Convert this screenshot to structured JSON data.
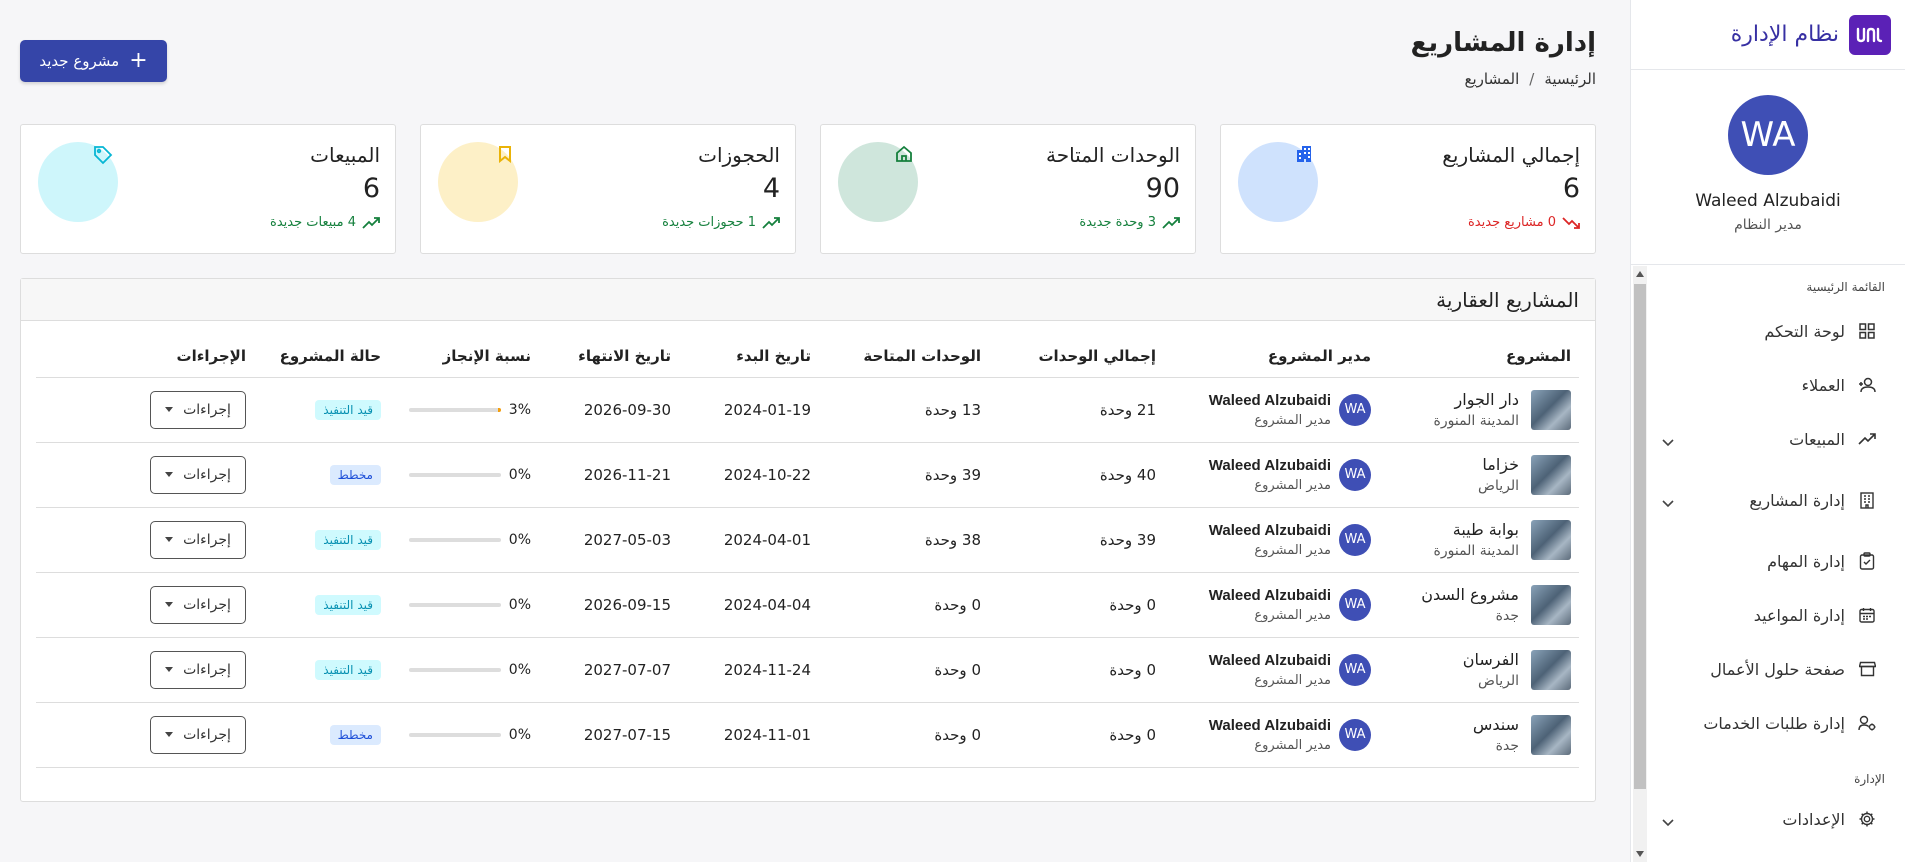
{
  "brand": {
    "name": "نظام الإدارة"
  },
  "user": {
    "initials": "WA",
    "name": "Waleed Alzubaidi",
    "role": "مدير النظام"
  },
  "sidebar": {
    "main_section": "القائمة الرئيسية",
    "admin_section": "الإدارة",
    "items": [
      {
        "label": "لوحة التحكم",
        "icon": "dashboard-icon"
      },
      {
        "label": "العملاء",
        "icon": "users-icon"
      },
      {
        "label": "المبيعات",
        "icon": "trending-up-icon"
      },
      {
        "label": "إدارة المشاريع",
        "icon": "building-icon"
      },
      {
        "label": "إدارة المهام",
        "icon": "clipboard-check-icon"
      },
      {
        "label": "إدارة المواعيد",
        "icon": "calendar-icon"
      },
      {
        "label": "صفحة حلول الأعمال",
        "icon": "store-icon"
      },
      {
        "label": "إدارة طلبات الخدمات",
        "icon": "service-icon"
      }
    ],
    "settings": {
      "label": "الإعدادات",
      "icon": "gear-icon"
    }
  },
  "header": {
    "title": "إدارة المشاريع",
    "breadcrumb": [
      "الرئيسية",
      "المشاريع"
    ],
    "new_button": "مشروع جديد"
  },
  "stats": [
    {
      "title": "إجمالي المشاريع",
      "value": "6",
      "trend": "0 مشاريع جديدة",
      "trend_color": "#dc2626",
      "circle": "#cfe2fd",
      "icon_color": "#2563eb"
    },
    {
      "title": "الوحدات المتاحة",
      "value": "90",
      "trend": "3 وحدة جديدة",
      "trend_color": "#15803d",
      "circle": "#cfe6dc",
      "icon_color": "#15803d"
    },
    {
      "title": "الحجوزات",
      "value": "4",
      "trend": "1 حجوزات جديدة",
      "trend_color": "#15803d",
      "circle": "#fdf0c7",
      "icon_color": "#eab308"
    },
    {
      "title": "المبيعات",
      "value": "6",
      "trend": "4 مبيعات جديدة",
      "trend_color": "#15803d",
      "circle": "#cef6fb",
      "icon_color": "#06b6d4"
    }
  ],
  "table": {
    "title": "المشاريع العقارية",
    "columns": [
      "المشروع",
      "مدير المشروع",
      "إجمالي الوحدات",
      "الوحدات المتاحة",
      "تاريخ البدء",
      "تاريخ الانتهاء",
      "نسبة الإنجاز",
      "حالة المشروع",
      "الإجراءات"
    ],
    "action_label": "إجراءات",
    "rows": [
      {
        "name": "دار الجوار",
        "city": "المدينة المنورة",
        "manager": "Waleed Alzubaidi",
        "manager_role": "مدير المشروع",
        "total": "21 وحدة",
        "available": "13 وحدة",
        "start": "2024-01-19",
        "end": "2026-09-30",
        "progress": 3,
        "progress_label": "3%",
        "status": "قيد التنفيذ",
        "status_type": "blue"
      },
      {
        "name": "خزاما",
        "city": "الرياض",
        "manager": "Waleed Alzubaidi",
        "manager_role": "مدير المشروع",
        "total": "40 وحدة",
        "available": "39 وحدة",
        "start": "2024-10-22",
        "end": "2026-11-21",
        "progress": 0,
        "progress_label": "0%",
        "status": "مخطط",
        "status_type": "plan"
      },
      {
        "name": "بوابة طيبة",
        "city": "المدينة المنورة",
        "manager": "Waleed Alzubaidi",
        "manager_role": "مدير المشروع",
        "total": "39 وحدة",
        "available": "38 وحدة",
        "start": "2024-04-01",
        "end": "2027-05-03",
        "progress": 0,
        "progress_label": "0%",
        "status": "قيد التنفيذ",
        "status_type": "blue"
      },
      {
        "name": "مشروع السدن",
        "city": "جدة",
        "manager": "Waleed Alzubaidi",
        "manager_role": "مدير المشروع",
        "total": "0 وحدة",
        "available": "0 وحدة",
        "start": "2024-04-04",
        "end": "2026-09-15",
        "progress": 0,
        "progress_label": "0%",
        "status": "قيد التنفيذ",
        "status_type": "blue"
      },
      {
        "name": "الفرسان",
        "city": "الرياض",
        "manager": "Waleed Alzubaidi",
        "manager_role": "مدير المشروع",
        "total": "0 وحدة",
        "available": "0 وحدة",
        "start": "2024-11-24",
        "end": "2027-07-07",
        "progress": 0,
        "progress_label": "0%",
        "status": "قيد التنفيذ",
        "status_type": "blue"
      },
      {
        "name": "سندس",
        "city": "جدة",
        "manager": "Waleed Alzubaidi",
        "manager_role": "مدير المشروع",
        "total": "0 وحدة",
        "available": "0 وحدة",
        "start": "2024-11-01",
        "end": "2027-07-15",
        "progress": 0,
        "progress_label": "0%",
        "status": "مخطط",
        "status_type": "plan"
      }
    ]
  }
}
